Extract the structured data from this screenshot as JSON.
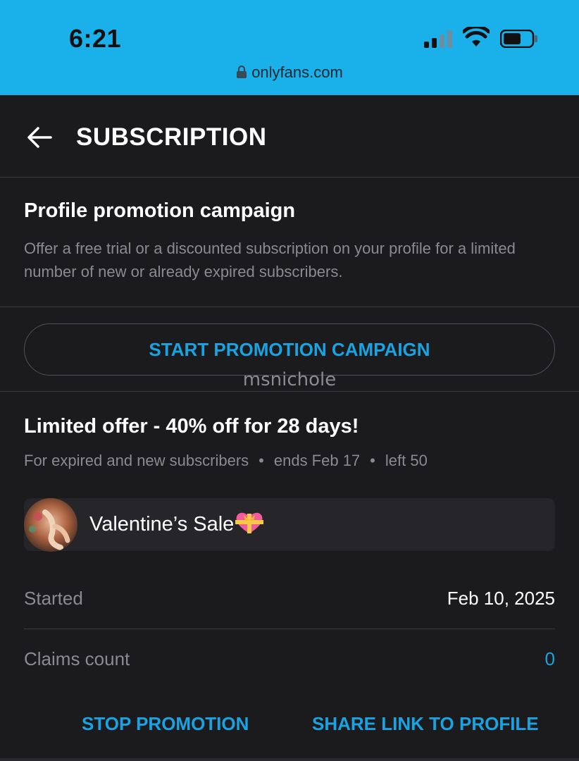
{
  "status_bar": {
    "time": "6:21",
    "url": "onlyfans.com",
    "icons": [
      "signal-icon",
      "wifi-icon",
      "battery-icon",
      "lock-icon"
    ],
    "background_color": "#1ab0ea"
  },
  "header": {
    "title": "SUBSCRIPTION",
    "back_icon": "arrow-left-icon"
  },
  "promotion": {
    "heading": "Profile promotion campaign",
    "description": "Offer a free trial or a discounted subscription on your profile for a limited number of new or already expired subscribers.",
    "start_button_label": "START PROMOTION CAMPAIGN",
    "watermark": "msnichole"
  },
  "offer": {
    "title": "Limited offer - 40% off for 28 days!",
    "audience": "For expired and new subscribers",
    "ends": "ends Feb 17",
    "left": "left 50",
    "separator": "•",
    "campaign_name": "Valentine’s Sale",
    "campaign_icon": "heart-gift-emoji",
    "started_label": "Started",
    "started_value": "Feb 10, 2025",
    "claims_label": "Claims count",
    "claims_value": "0"
  },
  "actions": {
    "stop_label": "STOP PROMOTION",
    "share_label": "SHARE LINK TO PROFILE"
  },
  "colors": {
    "accent": "#1aa3e0",
    "background": "#1b1b1d",
    "muted_text": "#8a8a90"
  }
}
